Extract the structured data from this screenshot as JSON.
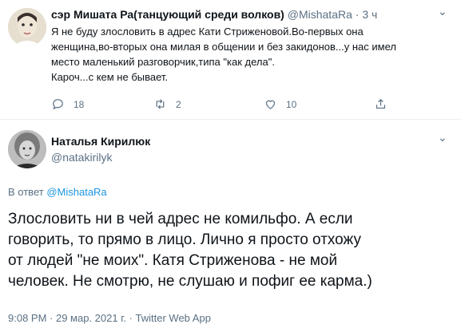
{
  "tweet1": {
    "author_name": "сэр Мишата Ра(танцующий среди волков)",
    "author_handle": "@MishataRa",
    "separator": "·",
    "time": "3 ч",
    "avatar_icon": "author-photo",
    "more_icon": "chevron-down-icon",
    "text_lines": [
      "Я не буду злословить в адрес Кати Стриженовой.Во-первых она",
      "женщина,во-вторых она милая в общении и без закидонов...у нас имел",
      "место маленький разговорчик,типа \"как дела\".",
      "Кароч...с кем не бывает."
    ],
    "actions": {
      "reply_count": "18",
      "retweet_count": "2",
      "like_count": "10"
    }
  },
  "tweet2": {
    "author_name": "Наталья Кирилюк",
    "author_handle": "@natakirilyk",
    "avatar_icon": "author-photo",
    "more_icon": "chevron-down-icon",
    "reply_prefix": "В ответ",
    "reply_handle": "@MishataRa",
    "text_lines": [
      "Злословить ни в чей адрес не комильфо. А если",
      "говорить, то прямо в лицо. Лично я просто отхожу",
      "от людей \"не моих\". Катя Стриженова - не мой",
      "человек. Не смотрю, не слушаю и пофиг ее карма.)"
    ],
    "meta": "9:08 PM · 29 мар. 2021 г. · Twitter Web App"
  },
  "colors": {
    "text": "#0f1419",
    "muted": "#5b7083",
    "link": "#1b95e0",
    "divider": "#ebeef0"
  }
}
